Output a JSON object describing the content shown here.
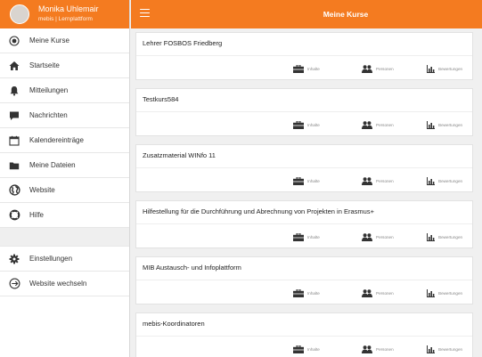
{
  "user": {
    "name": "Monika Uhlemair",
    "subtitle": "mebis | Lernplattform"
  },
  "header": {
    "title": "Meine Kurse",
    "menu_icon": "hamburger-icon",
    "accent_color": "#f47b20"
  },
  "sidebar": {
    "items": [
      {
        "label": "Meine Kurse",
        "icon": "radio-circle-icon"
      },
      {
        "label": "Startseite",
        "icon": "home-icon"
      },
      {
        "label": "Mitteilungen",
        "icon": "bell-icon"
      },
      {
        "label": "Nachrichten",
        "icon": "chat-bubble-icon"
      },
      {
        "label": "Kalendereinträge",
        "icon": "calendar-icon"
      },
      {
        "label": "Meine Dateien",
        "icon": "folder-icon"
      },
      {
        "label": "Website",
        "icon": "globe-icon"
      },
      {
        "label": "Hilfe",
        "icon": "lifebuoy-icon"
      }
    ],
    "bottom_items": [
      {
        "label": "Einstellungen",
        "icon": "gear-icon"
      },
      {
        "label": "Website wechseln",
        "icon": "switch-arrow-icon"
      }
    ]
  },
  "actions": {
    "contents": "Inhalte",
    "people": "Personen",
    "ratings": "Bewertungen"
  },
  "courses": [
    {
      "title": "Lehrer FOSBOS Friedberg"
    },
    {
      "title": "Testkurs584"
    },
    {
      "title": "Zusatzmaterial WINfo 11"
    },
    {
      "title": "Hilfestellung für die Durchführung und Abrechnung von Projekten in Erasmus+"
    },
    {
      "title": "MIB Austausch- und Infoplattform"
    },
    {
      "title": "mebis-Koordinatoren"
    }
  ]
}
